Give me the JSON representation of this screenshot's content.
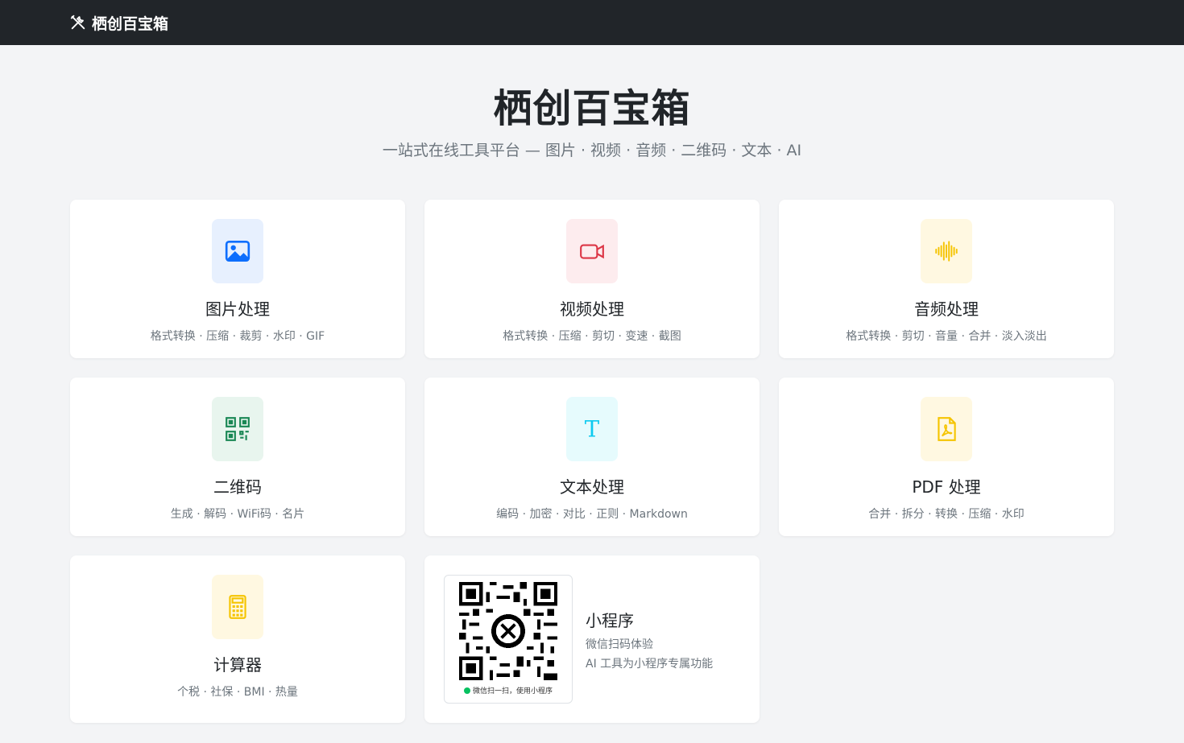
{
  "navbar": {
    "brand": "栖创百宝箱",
    "brand_icon": "tools-icon"
  },
  "hero": {
    "title": "栖创百宝箱",
    "subtitle": "一站式在线工具平台 — 图片 · 视频 · 音频 · 二维码 · 文本 · AI"
  },
  "cards": [
    {
      "title": "图片处理",
      "desc": "格式转换 · 压缩 · 裁剪 · 水印 · GIF",
      "icon": "image-icon",
      "icon_bg": "#e7f0fe",
      "icon_color": "#0d6efd"
    },
    {
      "title": "视频处理",
      "desc": "格式转换 · 压缩 · 剪切 · 变速 · 截图",
      "icon": "video-camera-icon",
      "icon_bg": "#fdecee",
      "icon_color": "#dc3545"
    },
    {
      "title": "音频处理",
      "desc": "格式转换 · 剪切 · 音量 · 合并 · 淡入淡出",
      "icon": "soundwave-icon",
      "icon_bg": "#fff8e1",
      "icon_color": "#f5c400"
    },
    {
      "title": "二维码",
      "desc": "生成 · 解码 · WiFi码 · 名片",
      "icon": "qr-code-icon",
      "icon_bg": "#e8f5ee",
      "icon_color": "#198754"
    },
    {
      "title": "文本处理",
      "desc": "编码 · 加密 · 对比 · 正则 · Markdown",
      "icon": "text-icon",
      "icon_bg": "#e6fbfd",
      "icon_color": "#0dcaf0"
    },
    {
      "title": "PDF 处理",
      "desc": "合并 · 拆分 · 转换 · 压缩 · 水印",
      "icon": "pdf-file-icon",
      "icon_bg": "#fff8e1",
      "icon_color": "#f5c400"
    },
    {
      "title": "计算器",
      "desc": "个税 · 社保 · BMI · 热量",
      "icon": "calculator-icon",
      "icon_bg": "#fff8e1",
      "icon_color": "#f5c400"
    }
  ],
  "mini_program": {
    "title": "小程序",
    "line1": "微信扫码体验",
    "line2": "AI 工具为小程序专属功能",
    "qr_caption": "微信扫一扫，使用小程序"
  }
}
